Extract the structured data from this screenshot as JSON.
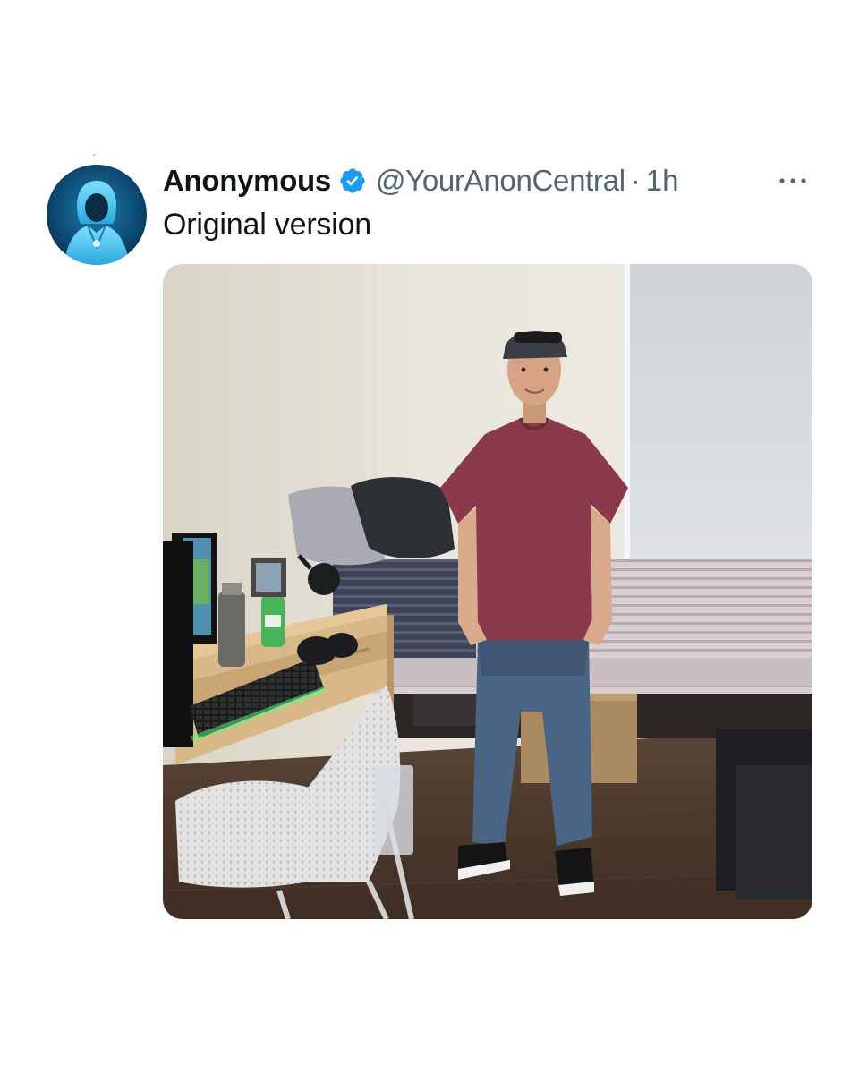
{
  "tweet": {
    "display_name": "Anonymous",
    "handle": "@YourAnonCentral",
    "separator": "·",
    "time": "1h",
    "text": "Original version"
  },
  "icons": {
    "avatar": "hooded-figure-avatar",
    "verified": "verified-badge-icon",
    "more": "more-options-icon"
  },
  "colors": {
    "verified_blue": "#1d9bf0",
    "secondary_text": "#536471",
    "primary_text": "#0f1419"
  }
}
